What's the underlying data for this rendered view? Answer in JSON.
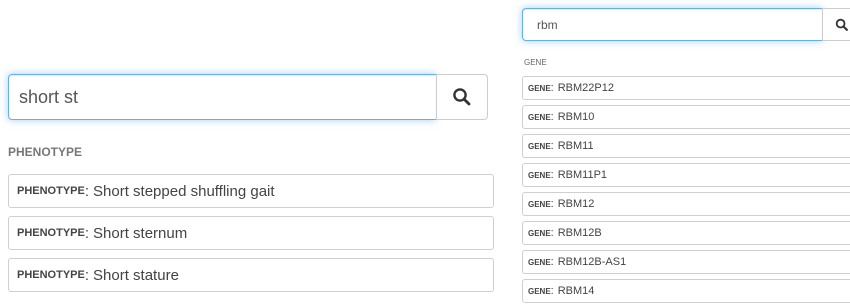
{
  "phenotype_search": {
    "query": "short st",
    "search_icon": "search-icon",
    "section_title": "PHENOTYPE",
    "result_type_label": "PHENOTYPE",
    "results": [
      "Short stepped shuffling gait",
      "Short sternum",
      "Short stature"
    ]
  },
  "gene_search": {
    "query": "rbm",
    "search_icon": "search-icon",
    "section_title": "GENE",
    "result_type_label": "GENE",
    "results": [
      "RBM22P12",
      "RBM10",
      "RBM11",
      "RBM11P1",
      "RBM12",
      "RBM12B",
      "RBM12B-AS1",
      "RBM14"
    ]
  },
  "colors": {
    "focus_border": "#66afe9",
    "item_border": "#cfcfcf",
    "heading_text": "#777777"
  }
}
